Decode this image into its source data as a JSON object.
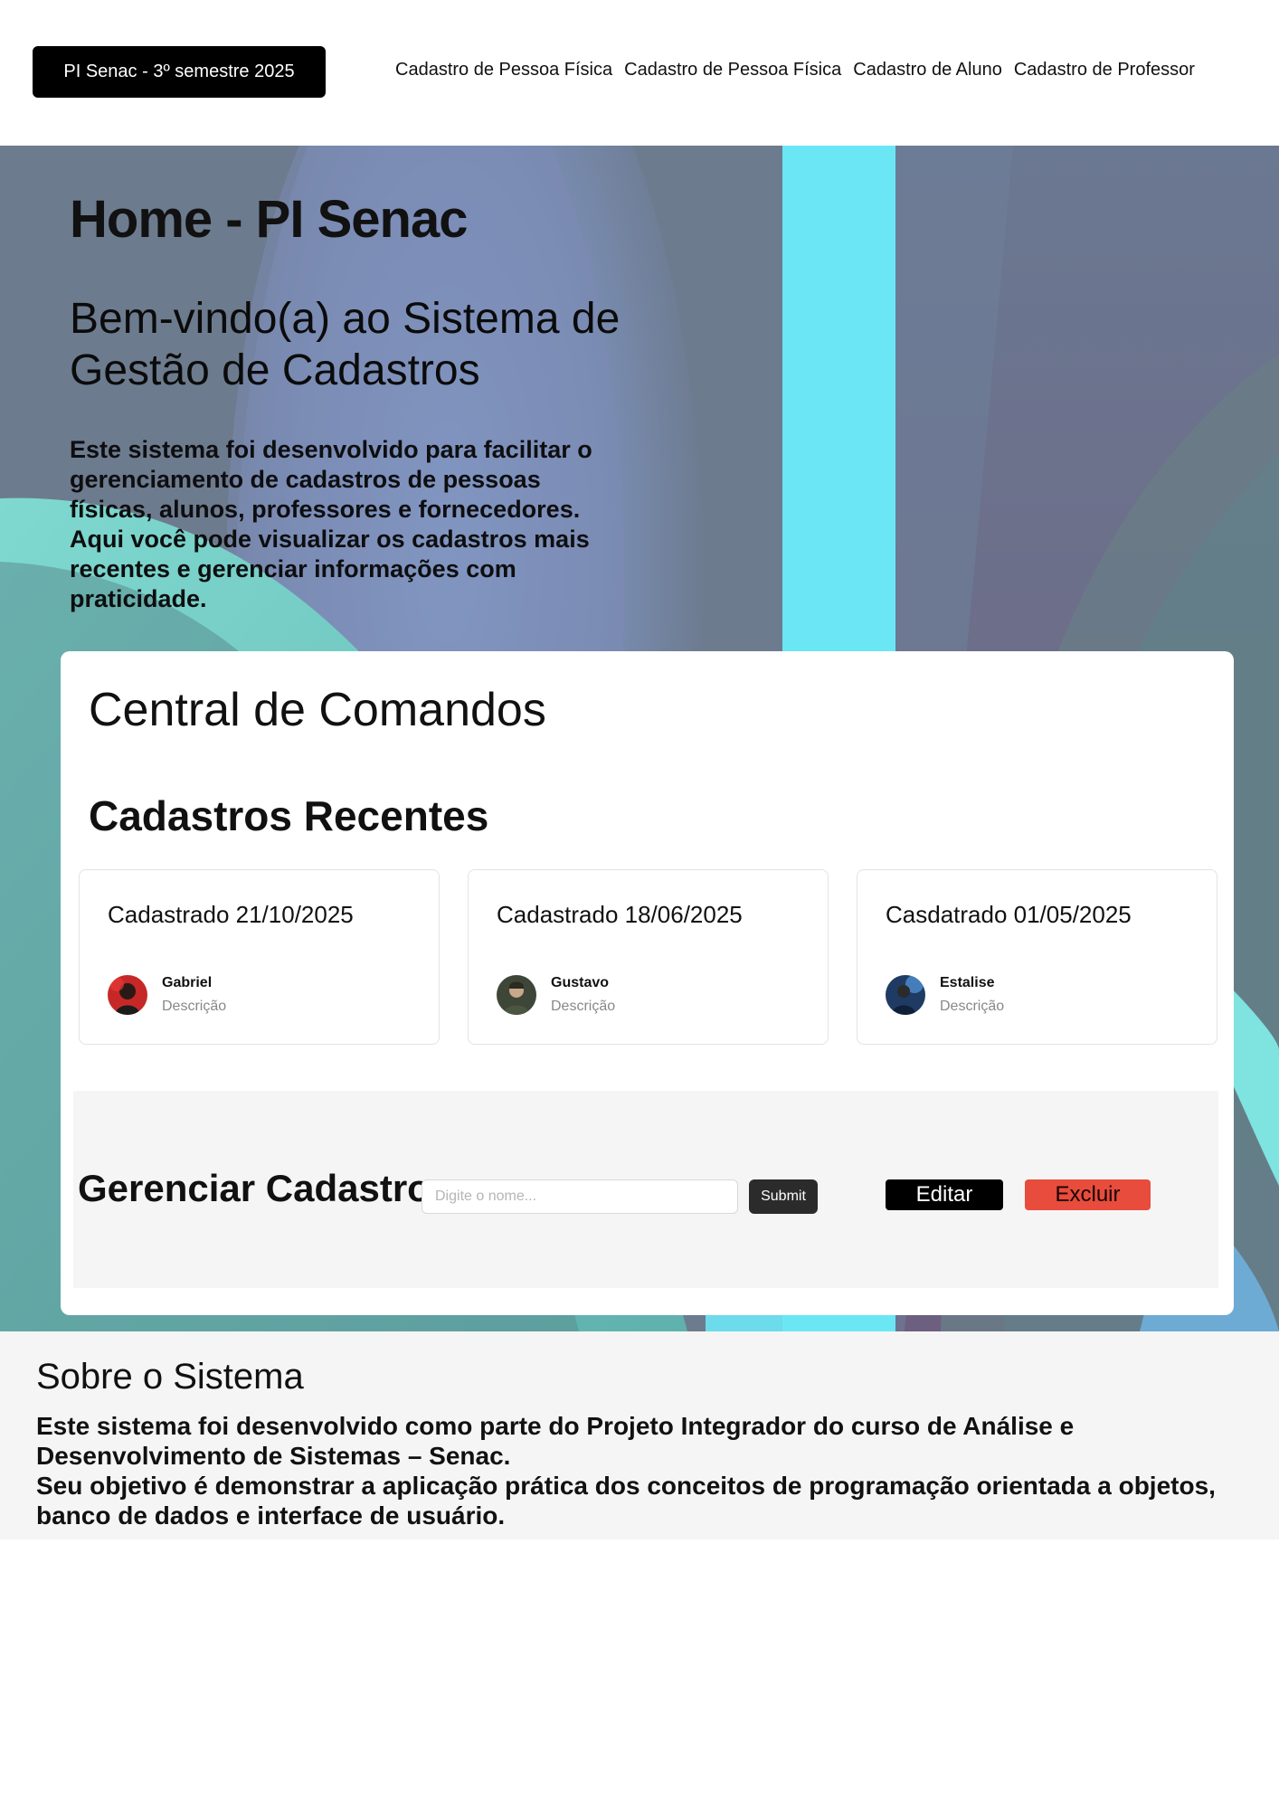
{
  "header": {
    "brand": "PI Senac - 3º semestre 2025",
    "nav": [
      "Cadastro de Pessoa Física",
      "Cadastro de Pessoa Física",
      "Cadastro de Aluno",
      "Cadastro de Professor"
    ]
  },
  "hero": {
    "title": "Home - PI Senac",
    "subtitle": "Bem-vindo(a) ao Sistema de Gestão de Cadastros",
    "text": "Este sistema foi desenvolvido para facilitar o gerenciamento de cadastros de pessoas físicas, alunos, professores e fornecedores.\n Aqui você pode visualizar os cadastros mais recentes e gerenciar informações com praticidade."
  },
  "panel": {
    "title": "Central de Comandos",
    "recent_title": "Cadastros Recentes",
    "cards": [
      {
        "date": "Cadastrado 21/10/2025",
        "name": "Gabriel",
        "description": "Descrição"
      },
      {
        "date": "Cadastrado 18/06/2025",
        "name": "Gustavo",
        "description": "Descrição"
      },
      {
        "date": "Casdatrado 01/05/2025",
        "name": "Estalise",
        "description": "Descrição"
      }
    ],
    "manage": {
      "title": "Gerenciar Cadastro",
      "search_placeholder": "Digite o nome...",
      "submit_label": "Submit",
      "edit_label": "Editar",
      "delete_label": "Excluir"
    }
  },
  "about": {
    "title": "Sobre o Sistema",
    "text": "Este sistema foi desenvolvido como parte do Projeto Integrador do curso de Análise e Desenvolvimento de Sistemas – Senac.\n Seu objetivo é demonstrar a aplicação prática dos conceitos de programação orientada a objetos, banco de dados e interface de usuário."
  },
  "colors": {
    "brand_bg": "#000000",
    "hero_bg": "#6c7a8e",
    "accent_cyan": "#6be6f5",
    "delete": "#e74c3c",
    "panel_bg": "#ffffff",
    "about_bg": "#f5f5f5"
  }
}
